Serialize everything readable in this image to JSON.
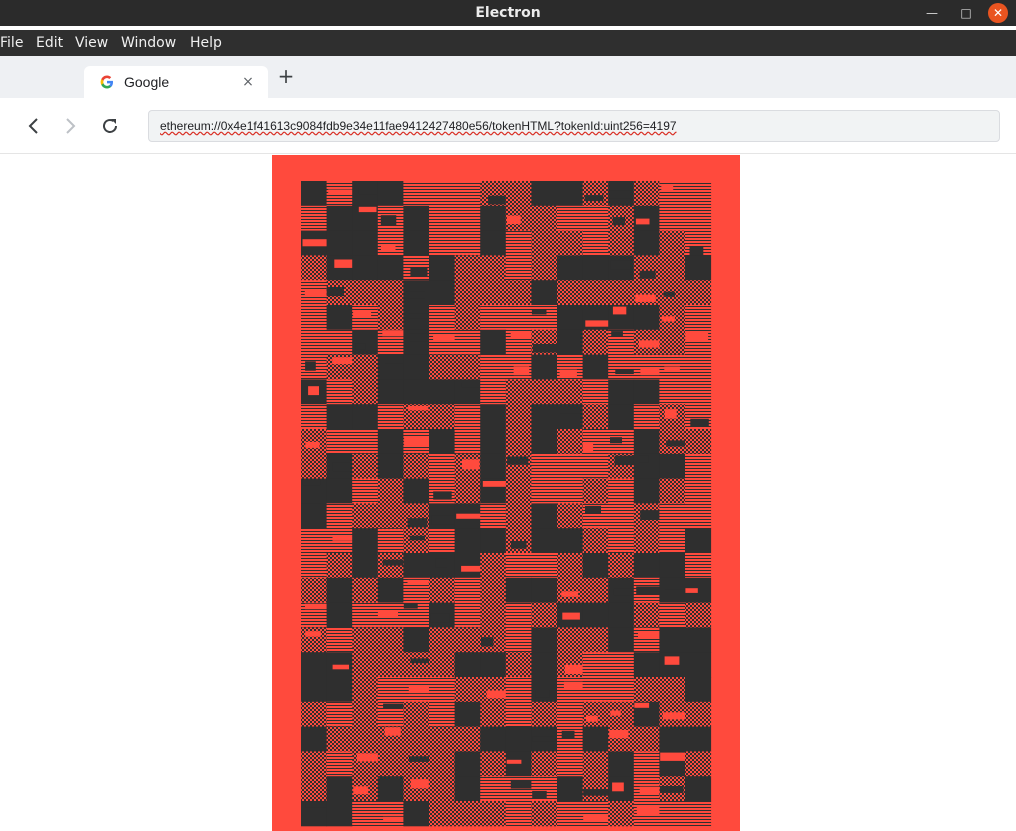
{
  "window": {
    "title": "Electron"
  },
  "menu": {
    "items": [
      "File",
      "Edit",
      "View",
      "Window",
      "Help"
    ]
  },
  "tabs": [
    {
      "label": "Google",
      "favicon": "google-g-icon"
    }
  ],
  "toolbar": {
    "url": "ethereum://0x4e1f41613c9084fdb9e34e11fae9412427480e56/tokenHTML?tokenId:uint256=4197"
  },
  "artwork": {
    "background_color": "#ff4a3d",
    "ink_color": "#2f2f2f",
    "description_icon": "generative-pixel-art"
  }
}
